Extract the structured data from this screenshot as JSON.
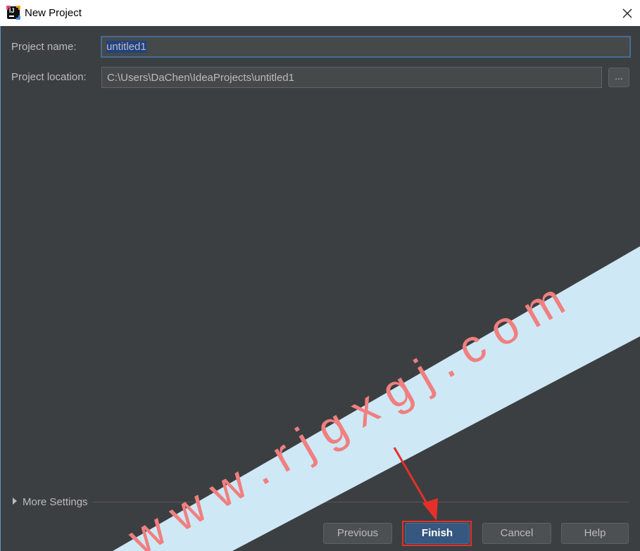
{
  "window": {
    "title": "New Project",
    "close_icon": "close-icon",
    "app_icon": "intellij-icon"
  },
  "form": {
    "project_name_label": "Project name:",
    "project_name_value": "untitled1",
    "project_location_label": "Project location:",
    "project_location_value": "C:\\Users\\DaChen\\IdeaProjects\\untitled1",
    "browse_label": "..."
  },
  "more_settings": {
    "label": "More Settings",
    "icon": "triangle-right-icon"
  },
  "buttons": {
    "previous": "Previous",
    "finish": "Finish",
    "cancel": "Cancel",
    "help": "Help"
  },
  "watermark": {
    "text": "w w w . r j g x g j . c o m",
    "color": "#f07f7f",
    "band_color": "#cfe8f6"
  },
  "colors": {
    "background": "#3c3f41",
    "field": "#45494a",
    "selection": "#214283",
    "primary_button": "#365880",
    "highlight": "#e4302b"
  }
}
